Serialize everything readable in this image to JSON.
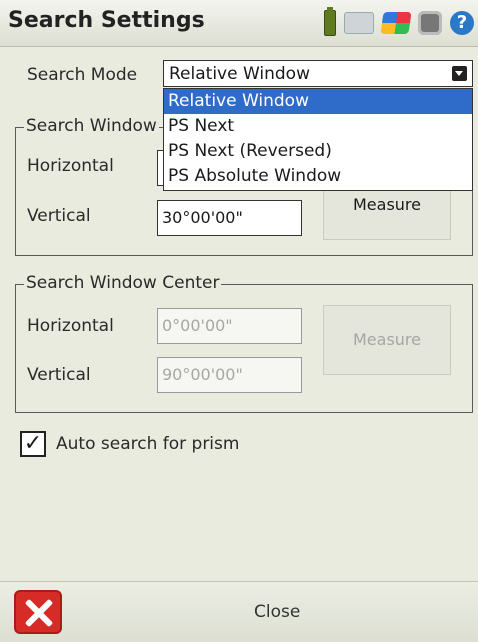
{
  "window": {
    "title": "Search Settings"
  },
  "status_icons": [
    "battery-icon",
    "keyboard-icon",
    "windows-start-icon",
    "apps-icon",
    "help-icon"
  ],
  "search_mode": {
    "label": "Search Mode",
    "selected": "Relative Window",
    "options": [
      "Relative Window",
      "PS Next",
      "PS Next (Reversed)",
      "PS Absolute Window"
    ]
  },
  "search_window": {
    "title": "Search Window",
    "horizontal_label": "Horizontal",
    "horizontal_value": "",
    "vertical_label": "Vertical",
    "vertical_value": "30°00'00\"",
    "measure_label": "Measure"
  },
  "search_window_center": {
    "title": "Search Window Center",
    "horizontal_label": "Horizontal",
    "horizontal_value": "0°00'00\"",
    "vertical_label": "Vertical",
    "vertical_value": "90°00'00\"",
    "measure_label": "Measure"
  },
  "auto_search": {
    "label": "Auto search for prism",
    "checked": true
  },
  "footer": {
    "close_label": "Close"
  },
  "colors": {
    "selection": "#2f6bc9",
    "background": "#e9ebdf",
    "close_red": "#d72b27"
  }
}
